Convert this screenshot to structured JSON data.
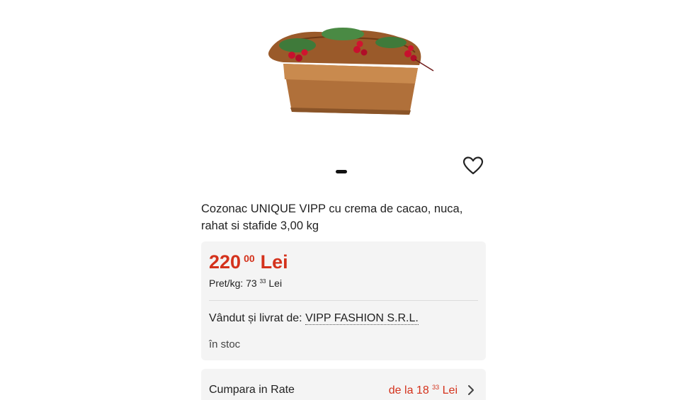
{
  "product": {
    "title": "Cozonac UNIQUE VIPP cu crema de cacao, nuca, rahat si stafide 3,00 kg",
    "image_icon": "cozonac-product-image"
  },
  "price": {
    "integer": "220",
    "decimals": "00",
    "currency": "Lei",
    "per_kg_label": "Pret/kg: 73",
    "per_kg_decimals": "33",
    "per_kg_currency": "Lei"
  },
  "seller": {
    "label": "Vândut și livrat de:",
    "name": "VIPP FASHION S.R.L."
  },
  "stock": {
    "status": "în stoc"
  },
  "installments": {
    "label": "Cumpara in Rate",
    "prefix": "de la 18",
    "decimals": "33",
    "currency": "Lei"
  },
  "colors": {
    "accent": "#d4321c",
    "card_bg": "#f4f4f4"
  },
  "icons": {
    "favorite": "heart-outline-icon",
    "chevron": "chevron-right-icon"
  }
}
